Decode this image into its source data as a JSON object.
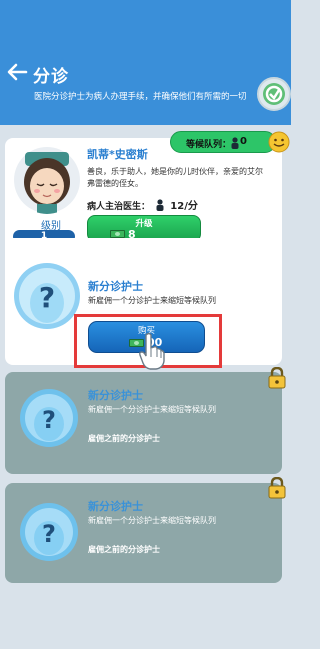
{
  "header": {
    "title": "分诊",
    "description": "医院分诊护士为病人办理手续，并确保他们有所需的一切"
  },
  "current_nurse": {
    "name": "凯蒂*史密斯",
    "description_line1": "善良，乐于助人，她是你的儿时伙伴，亲爱的艾尔",
    "description_line2": "弗雷德的侄女。",
    "level_label": "级别",
    "level_value": "1",
    "doctor_label": "病人主治医生：",
    "doctor_rate": "12/分",
    "upgrade_label": "升级",
    "upgrade_cost": "8",
    "queue_label": "等候队列：",
    "queue_value": "0"
  },
  "hire_card": {
    "title": "新分诊护士",
    "description": "新雇佣一个分诊护士来缩短等候队列",
    "buy_label": "购买",
    "buy_cost_visible": "00"
  },
  "locked_cards": [
    {
      "title": "新分诊护士",
      "description": "新雇佣一个分诊护士来缩短等候队列",
      "requirement": "雇佣之前的分诊护士"
    },
    {
      "title": "新分诊护士",
      "description": "新雇佣一个分诊护士来缩短等候队列",
      "requirement": "雇佣之前的分诊护士"
    }
  ],
  "colors": {
    "header_blue": "#3a8fd9",
    "green_button": "#2dc568",
    "blue_button": "#1f78cc",
    "locked_card": "#8ea7a8",
    "highlight_red": "#e43a3a"
  }
}
